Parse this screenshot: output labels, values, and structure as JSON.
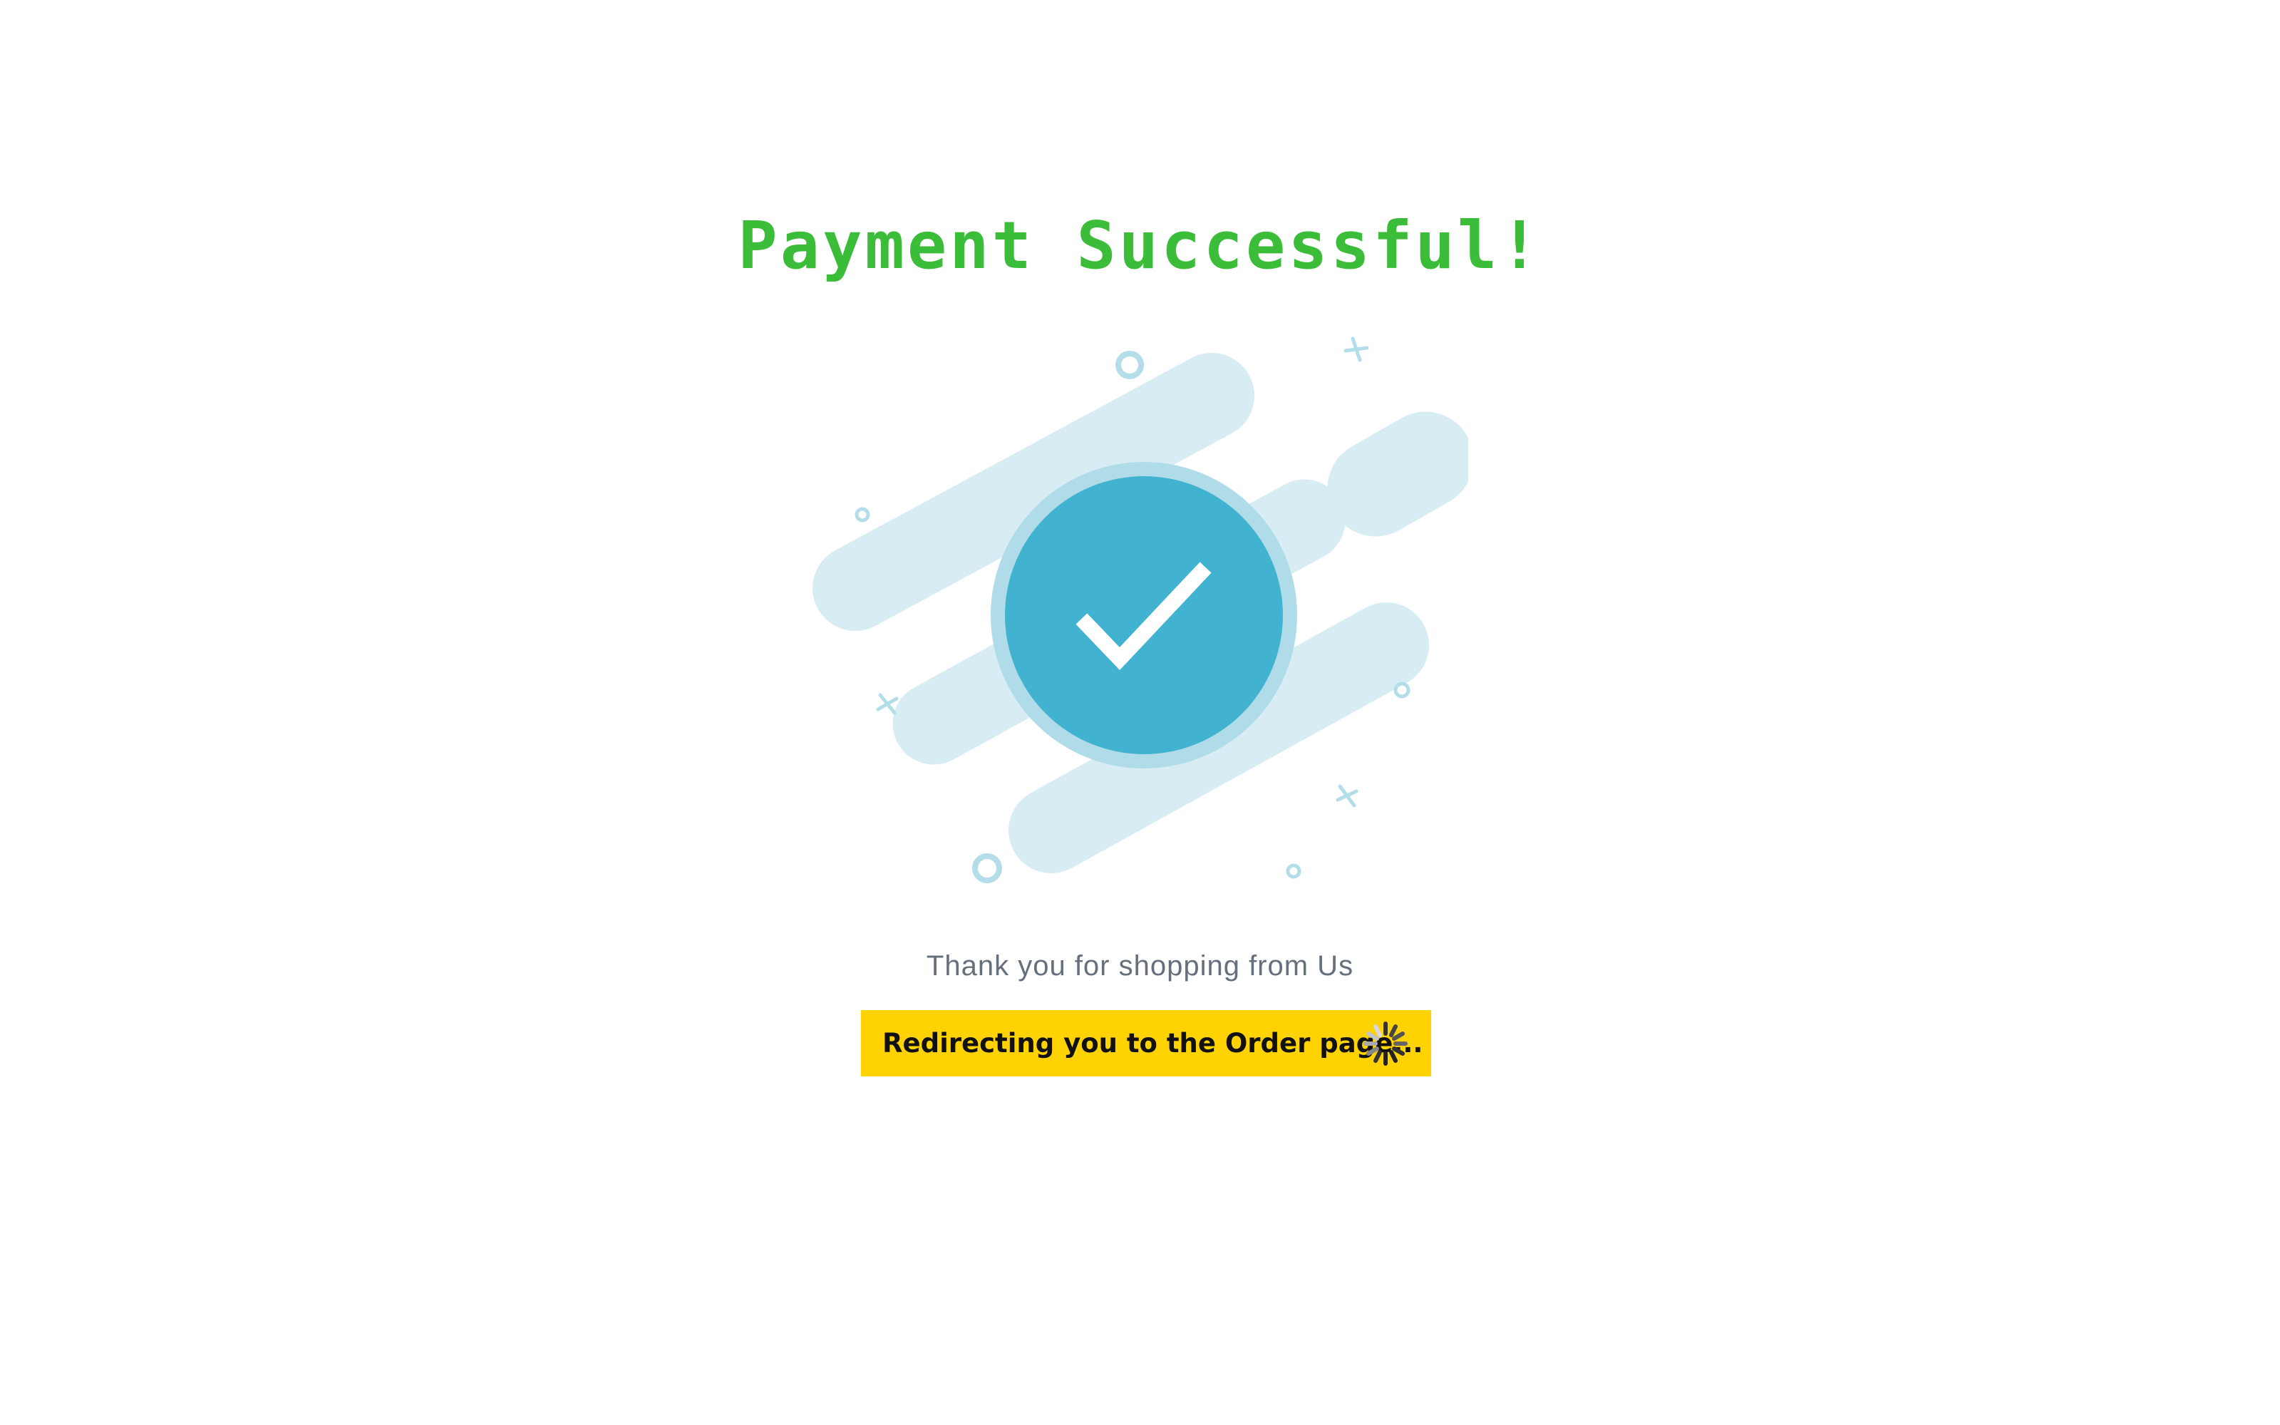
{
  "page": {
    "title": "Payment Successful!",
    "thanks_message": "Thank you for shopping from Us",
    "redirect_message": "Redirecting you to the Order page..."
  },
  "icons": {
    "success_illustration": "check-circle-icon",
    "loading": "spinner-icon"
  },
  "colors": {
    "title": "#3cbd3a",
    "check_circle": "#41b3d0",
    "decor": "#d6ecf3",
    "redirect_bar": "#ffd302",
    "thanks_text": "#66707d"
  }
}
